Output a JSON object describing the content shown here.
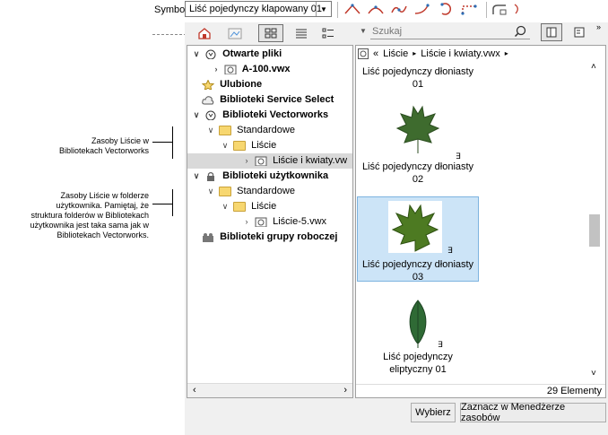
{
  "toolbar": {
    "symbol_label": "Symbol",
    "symbol_value": "Liść pojedynczy klapowany 01"
  },
  "search": {
    "placeholder": "Szukaj"
  },
  "breadcrumb": {
    "back": "«",
    "items": [
      "Liście",
      "Liście i kwiaty.vwx"
    ],
    "sep": "▸"
  },
  "tree": {
    "open_files": "Otwarte pliki",
    "file_a100": "A-100.vwx",
    "favorites": "Ulubione",
    "service_select": "Biblioteki Service Select",
    "vectorworks_libs": "Biblioteki Vectorworks",
    "standard_1": "Standardowe",
    "leaves_1": "Liście",
    "leaves_flowers": "Liście i kwiaty.vw",
    "user_libs": "Biblioteki użytkownika",
    "standard_2": "Standardowe",
    "leaves_2": "Liście",
    "leaves5": "Liście-5.vwx",
    "workgroup_libs": "Biblioteki grupy roboczej"
  },
  "grid": {
    "item1_line1": "Liść pojedynczy dłoniasty",
    "item1_line2": "01",
    "item2_line1": "Liść pojedynczy dłoniasty",
    "item2_line2": "02",
    "item3_line1": "Liść pojedynczy dłoniasty",
    "item3_line2": "03",
    "item4_line1": "Liść pojedynczy",
    "item4_line2": "eliptyczny 01",
    "status": "29 Elementy"
  },
  "buttons": {
    "select": "Wybierz",
    "show_in_rm": "Zaznacz w Menedżerze zasobów"
  },
  "callouts": {
    "c1": "Zasoby Liście w\nBibliotekach Vectorworks",
    "c2": "Zasoby Liście w folderze\nużytkownika. Pamiętaj, że\nstruktura folderów w Bibliotekach\nużytkownika jest taka sama jak w\nBibliotekach Vectorworks."
  },
  "colors": {
    "selection": "#cce4f7",
    "selection_border": "#7db3e0",
    "tree_selected": "#d9d9d9",
    "folder": "#f7d770",
    "leaf_green": "#3e6b2e"
  }
}
